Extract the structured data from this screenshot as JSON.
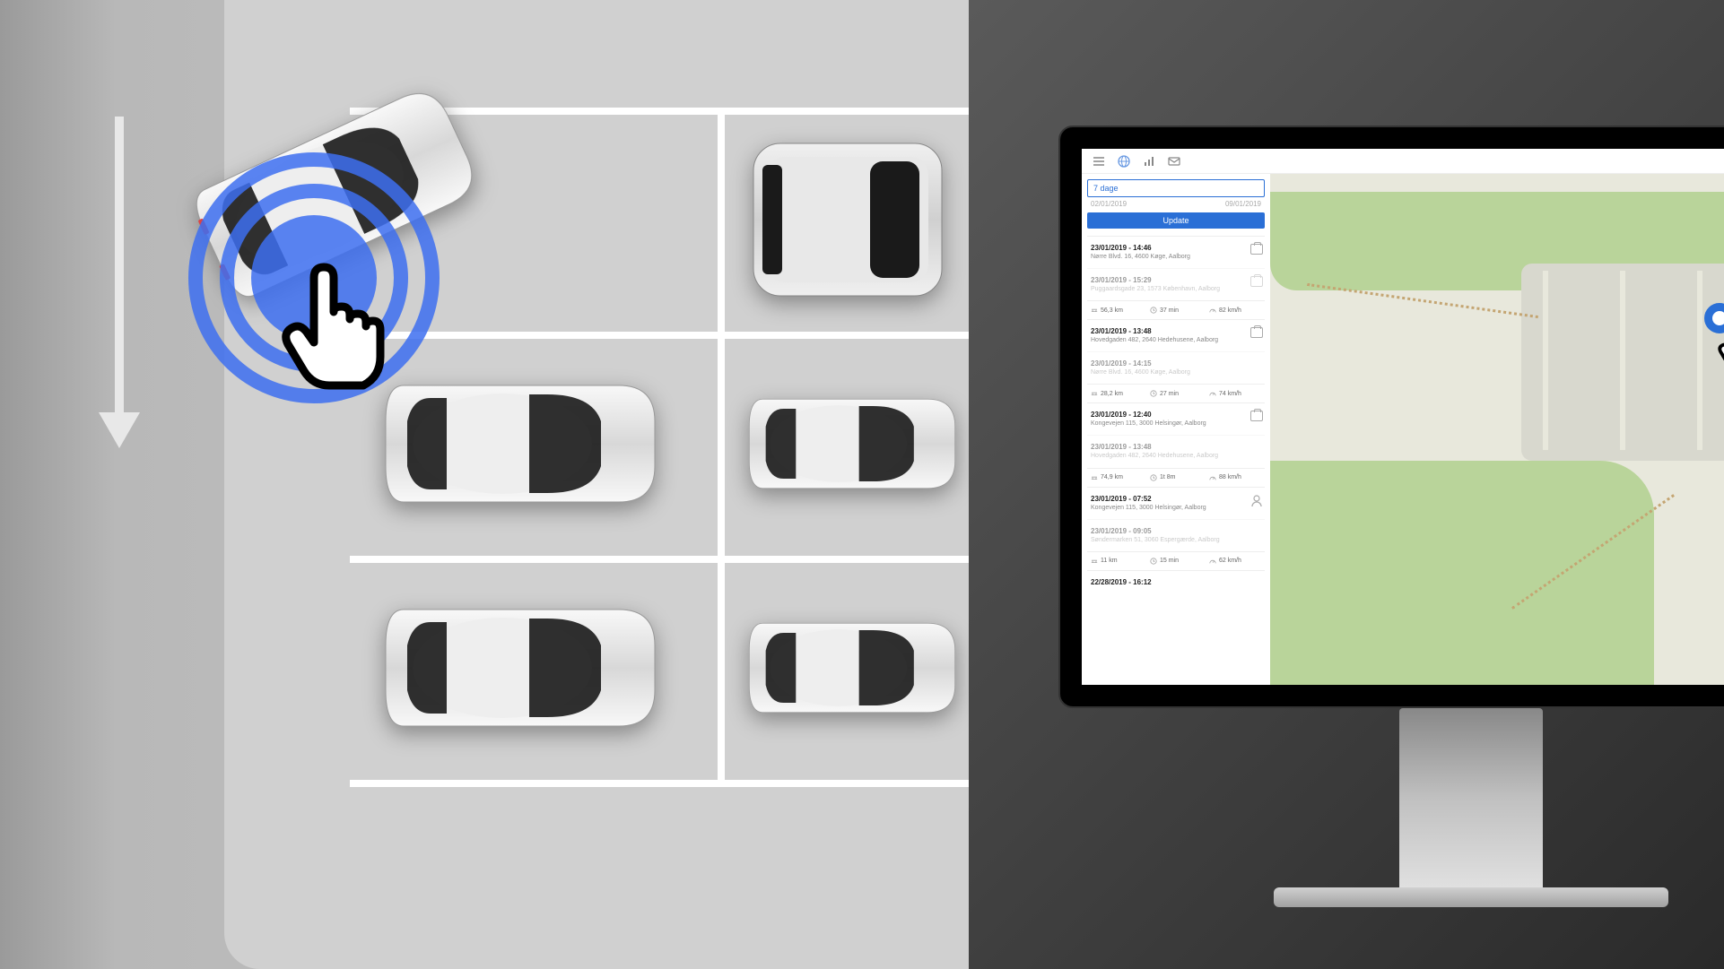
{
  "filter": {
    "range_label": "7 dage",
    "date_from": "02/01/2019",
    "date_to": "09/01/2019",
    "update_button": "Update"
  },
  "trips": [
    {
      "datetime": "23/01/2019 - 14:46",
      "address": "Nørre Blvd. 16, 4600 Køge, Aalborg",
      "type": "briefcase"
    },
    {
      "datetime": "23/01/2019 - 15:29",
      "address": "Puggaardsgade 23, 1573 København, Aalborg",
      "type": "briefcase",
      "dim": true
    },
    {
      "stats": {
        "distance": "56,3 km",
        "duration": "37 min",
        "speed": "82 km/h"
      }
    },
    {
      "datetime": "23/01/2019 - 13:48",
      "address": "Hovedgaden 482, 2640 Hedehusene, Aalborg",
      "type": "briefcase"
    },
    {
      "datetime": "23/01/2019 - 14:15",
      "address": "Nørre Blvd. 16, 4600 Køge, Aalborg",
      "type": "none",
      "dim": true
    },
    {
      "stats": {
        "distance": "28,2 km",
        "duration": "27 min",
        "speed": "74 km/h"
      }
    },
    {
      "datetime": "23/01/2019 - 12:40",
      "address": "Kongevejen 115, 3000 Helsingør, Aalborg",
      "type": "briefcase"
    },
    {
      "datetime": "23/01/2019 - 13:48",
      "address": "Hovedgaden 482, 2640 Hedehusene, Aalborg",
      "type": "none",
      "dim": true
    },
    {
      "stats": {
        "distance": "74,9 km",
        "duration": "1t 8m",
        "speed": "88 km/h"
      }
    },
    {
      "datetime": "23/01/2019 - 07:52",
      "address": "Kongevejen 115, 3000 Helsingør, Aalborg",
      "type": "person"
    },
    {
      "datetime": "23/01/2019 - 09:05",
      "address": "Søndermarken 51, 3060 Espergærde, Aalborg",
      "type": "none",
      "dim": true
    },
    {
      "stats": {
        "distance": "11 km",
        "duration": "15 min",
        "speed": "62 km/h"
      }
    },
    {
      "datetime": "22/28/2019 - 16:12",
      "address": "",
      "type": "none"
    }
  ],
  "colors": {
    "accent": "#2a6fd6",
    "ripple": "#3d6ef0",
    "map_green": "#b9d49a"
  }
}
